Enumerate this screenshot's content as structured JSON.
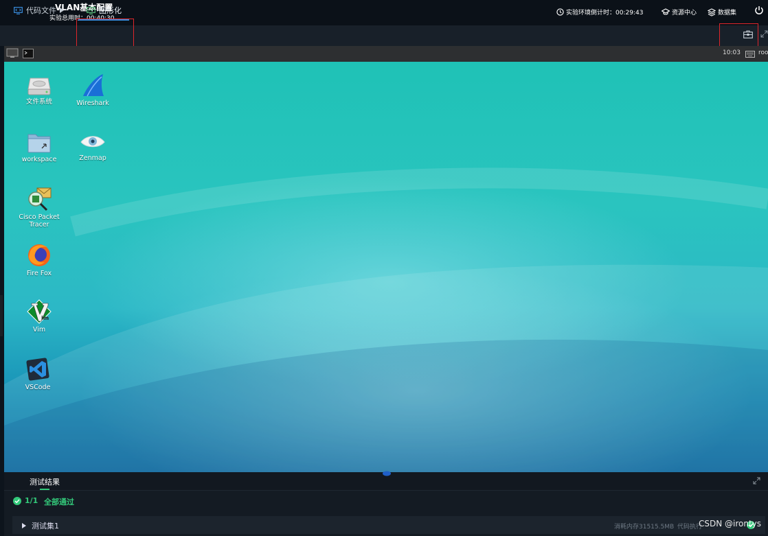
{
  "header": {
    "lab_title": "VLAN基本配置",
    "lab_total_time": "实验总用时：00:40:30",
    "env_countdown": "实验环境倒计时：00:29:43",
    "resource_center": "资源中心",
    "dataset": "数据集"
  },
  "tabs": {
    "code_files": "代码文件",
    "graphical": "图形化"
  },
  "desktop_panel": {
    "clock": "10:03",
    "user": "roo"
  },
  "desktop_icons": [
    {
      "label": "文件系统",
      "icon": "hard-drive-icon"
    },
    {
      "label": "Wireshark",
      "icon": "wireshark-fin-icon"
    },
    {
      "label": "workspace",
      "icon": "folder-icon"
    },
    {
      "label": "Zenmap",
      "icon": "zenmap-eye-icon"
    },
    {
      "label": "Cisco Packet Tracer",
      "icon": "packet-tracer-icon"
    },
    {
      "label": "Fire Fox",
      "icon": "firefox-icon"
    },
    {
      "label": "Vim",
      "icon": "vim-icon"
    },
    {
      "label": "VSCode",
      "icon": "vscode-icon"
    }
  ],
  "results": {
    "tab_label": "测试结果",
    "score": "1/1",
    "status": "全部通过",
    "suite_name": "测试集1",
    "memory": "消耗内存31515.5MB",
    "exec_time": "代码执行"
  },
  "watermark": "CSDN @irontys",
  "colors": {
    "accent_blue": "#3a8ee0",
    "pass_green": "#33c97a",
    "highlight_red": "#e0262b"
  }
}
